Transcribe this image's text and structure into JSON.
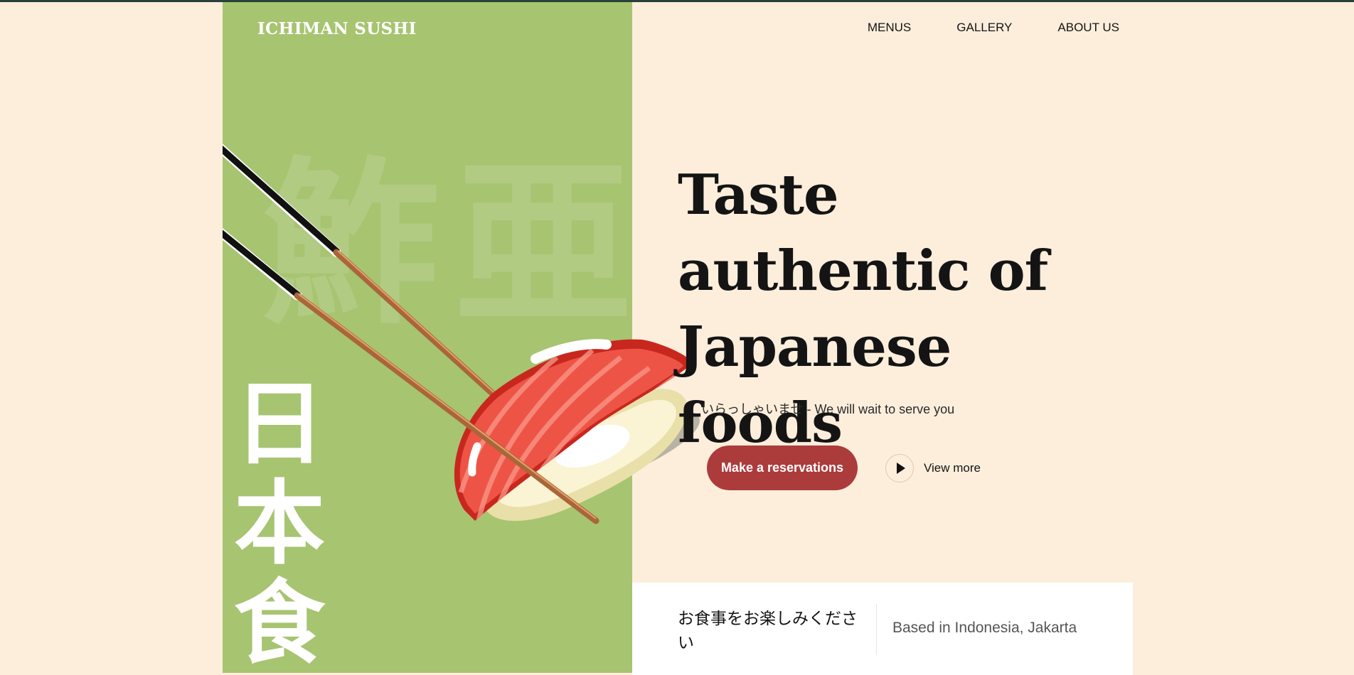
{
  "brand": {
    "name": "ICHIMAN SUSHI"
  },
  "nav": {
    "items": [
      "MENUS",
      "GALLERY",
      "ABOUT US"
    ]
  },
  "panel": {
    "watermark": "鮓亜",
    "kanji": [
      "日",
      "本",
      "食"
    ]
  },
  "hero": {
    "title": "Taste authentic of Japanese foods",
    "subtitle": "いらっしゃいませ - We will wait to serve you",
    "primary_button": "Make a reservations",
    "secondary_link": "View more"
  },
  "info": {
    "jp_text": "お食事をお楽しみください",
    "location": "Based in Indonesia, Jakarta"
  },
  "colors": {
    "background": "#fdeedc",
    "panel_green": "#a7c471",
    "accent_red": "#ac3b3c",
    "tuna": "#e84b3a"
  },
  "icons": {
    "play": "play-icon"
  }
}
